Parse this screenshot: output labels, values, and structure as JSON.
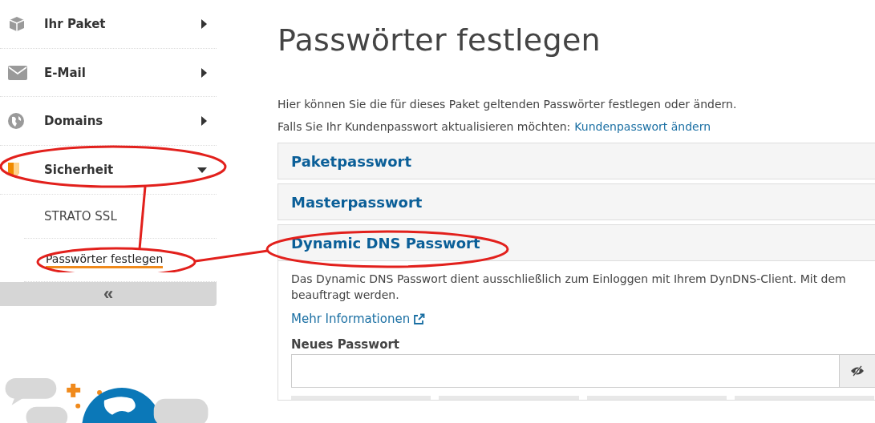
{
  "sidebar": {
    "items": [
      {
        "label": "Ihr Paket",
        "expanded": false
      },
      {
        "label": "E-Mail",
        "expanded": false
      },
      {
        "label": "Domains",
        "expanded": false
      },
      {
        "label": "Sicherheit",
        "expanded": true,
        "children": [
          {
            "label": "STRATO SSL",
            "selected": false
          },
          {
            "label": "Passwörter festlegen",
            "selected": true
          }
        ]
      }
    ],
    "collapse": "«"
  },
  "page": {
    "title": "Passwörter festlegen",
    "intro": "Hier können Sie die für dieses Paket geltenden Passwörter festlegen oder ändern.",
    "customer_text": "Falls Sie Ihr Kundenpasswort aktualisieren möchten:",
    "customer_link": "Kundenpasswort ändern",
    "panels": [
      {
        "title": "Paketpasswort"
      },
      {
        "title": "Masterpasswort"
      },
      {
        "title": "Dynamic DNS Passwort",
        "description": "Das Dynamic DNS Passwort dient ausschließlich zum Einloggen mit Ihrem DynDNS-Client. Mit dem",
        "description_2": "beauftragt werden.",
        "info_link": "Mehr Informationen",
        "field_label": "Neues Passwort"
      }
    ]
  }
}
